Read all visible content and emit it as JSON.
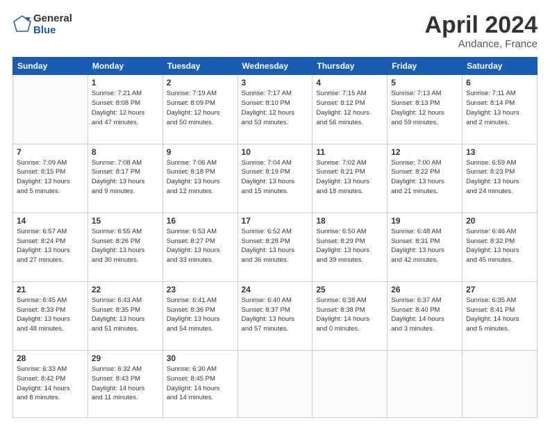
{
  "header": {
    "logo_line1": "General",
    "logo_line2": "Blue",
    "title": "April 2024",
    "subtitle": "Andance, France"
  },
  "columns": [
    "Sunday",
    "Monday",
    "Tuesday",
    "Wednesday",
    "Thursday",
    "Friday",
    "Saturday"
  ],
  "weeks": [
    [
      {
        "day": "",
        "info": ""
      },
      {
        "day": "1",
        "info": "Sunrise: 7:21 AM\nSunset: 8:08 PM\nDaylight: 12 hours\nand 47 minutes."
      },
      {
        "day": "2",
        "info": "Sunrise: 7:19 AM\nSunset: 8:09 PM\nDaylight: 12 hours\nand 50 minutes."
      },
      {
        "day": "3",
        "info": "Sunrise: 7:17 AM\nSunset: 8:10 PM\nDaylight: 12 hours\nand 53 minutes."
      },
      {
        "day": "4",
        "info": "Sunrise: 7:15 AM\nSunset: 8:12 PM\nDaylight: 12 hours\nand 56 minutes."
      },
      {
        "day": "5",
        "info": "Sunrise: 7:13 AM\nSunset: 8:13 PM\nDaylight: 12 hours\nand 59 minutes."
      },
      {
        "day": "6",
        "info": "Sunrise: 7:11 AM\nSunset: 8:14 PM\nDaylight: 13 hours\nand 2 minutes."
      }
    ],
    [
      {
        "day": "7",
        "info": "Sunrise: 7:09 AM\nSunset: 8:15 PM\nDaylight: 13 hours\nand 5 minutes."
      },
      {
        "day": "8",
        "info": "Sunrise: 7:08 AM\nSunset: 8:17 PM\nDaylight: 13 hours\nand 9 minutes."
      },
      {
        "day": "9",
        "info": "Sunrise: 7:06 AM\nSunset: 8:18 PM\nDaylight: 13 hours\nand 12 minutes."
      },
      {
        "day": "10",
        "info": "Sunrise: 7:04 AM\nSunset: 8:19 PM\nDaylight: 13 hours\nand 15 minutes."
      },
      {
        "day": "11",
        "info": "Sunrise: 7:02 AM\nSunset: 8:21 PM\nDaylight: 13 hours\nand 18 minutes."
      },
      {
        "day": "12",
        "info": "Sunrise: 7:00 AM\nSunset: 8:22 PM\nDaylight: 13 hours\nand 21 minutes."
      },
      {
        "day": "13",
        "info": "Sunrise: 6:59 AM\nSunset: 8:23 PM\nDaylight: 13 hours\nand 24 minutes."
      }
    ],
    [
      {
        "day": "14",
        "info": "Sunrise: 6:57 AM\nSunset: 8:24 PM\nDaylight: 13 hours\nand 27 minutes."
      },
      {
        "day": "15",
        "info": "Sunrise: 6:55 AM\nSunset: 8:26 PM\nDaylight: 13 hours\nand 30 minutes."
      },
      {
        "day": "16",
        "info": "Sunrise: 6:53 AM\nSunset: 8:27 PM\nDaylight: 13 hours\nand 33 minutes."
      },
      {
        "day": "17",
        "info": "Sunrise: 6:52 AM\nSunset: 8:28 PM\nDaylight: 13 hours\nand 36 minutes."
      },
      {
        "day": "18",
        "info": "Sunrise: 6:50 AM\nSunset: 8:29 PM\nDaylight: 13 hours\nand 39 minutes."
      },
      {
        "day": "19",
        "info": "Sunrise: 6:48 AM\nSunset: 8:31 PM\nDaylight: 13 hours\nand 42 minutes."
      },
      {
        "day": "20",
        "info": "Sunrise: 6:46 AM\nSunset: 8:32 PM\nDaylight: 13 hours\nand 45 minutes."
      }
    ],
    [
      {
        "day": "21",
        "info": "Sunrise: 6:45 AM\nSunset: 8:33 PM\nDaylight: 13 hours\nand 48 minutes."
      },
      {
        "day": "22",
        "info": "Sunrise: 6:43 AM\nSunset: 8:35 PM\nDaylight: 13 hours\nand 51 minutes."
      },
      {
        "day": "23",
        "info": "Sunrise: 6:41 AM\nSunset: 8:36 PM\nDaylight: 13 hours\nand 54 minutes."
      },
      {
        "day": "24",
        "info": "Sunrise: 6:40 AM\nSunset: 8:37 PM\nDaylight: 13 hours\nand 57 minutes."
      },
      {
        "day": "25",
        "info": "Sunrise: 6:38 AM\nSunset: 8:38 PM\nDaylight: 14 hours\nand 0 minutes."
      },
      {
        "day": "26",
        "info": "Sunrise: 6:37 AM\nSunset: 8:40 PM\nDaylight: 14 hours\nand 3 minutes."
      },
      {
        "day": "27",
        "info": "Sunrise: 6:35 AM\nSunset: 8:41 PM\nDaylight: 14 hours\nand 5 minutes."
      }
    ],
    [
      {
        "day": "28",
        "info": "Sunrise: 6:33 AM\nSunset: 8:42 PM\nDaylight: 14 hours\nand 8 minutes."
      },
      {
        "day": "29",
        "info": "Sunrise: 6:32 AM\nSunset: 8:43 PM\nDaylight: 14 hours\nand 11 minutes."
      },
      {
        "day": "30",
        "info": "Sunrise: 6:30 AM\nSunset: 8:45 PM\nDaylight: 14 hours\nand 14 minutes."
      },
      {
        "day": "",
        "info": ""
      },
      {
        "day": "",
        "info": ""
      },
      {
        "day": "",
        "info": ""
      },
      {
        "day": "",
        "info": ""
      }
    ]
  ]
}
